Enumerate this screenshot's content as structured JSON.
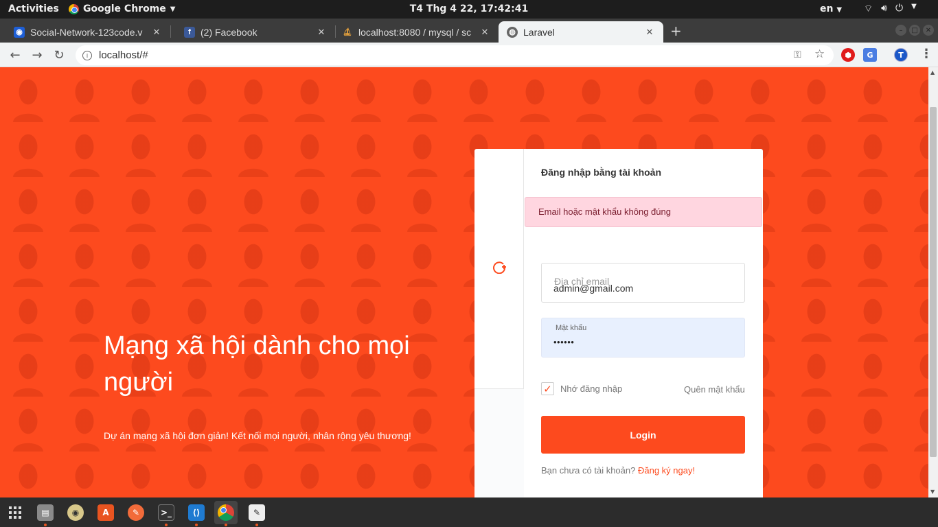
{
  "system_bar": {
    "activities": "Activities",
    "app_name": "Google Chrome",
    "clock": "T4 Thg 4 22, 17:42:41",
    "language": "en"
  },
  "tabs": [
    {
      "title": "Social-Network-123code.v",
      "favicon": "vscode-live-icon",
      "active": false
    },
    {
      "title": "(2) Facebook",
      "favicon": "facebook-icon",
      "active": false
    },
    {
      "title": "localhost:8080 / mysql / sc",
      "favicon": "phpmyadmin-icon",
      "active": false
    },
    {
      "title": "Laravel",
      "favicon": "globe-icon",
      "active": true
    }
  ],
  "address_bar": {
    "url": "localhost/#",
    "profile_initial": "T"
  },
  "hero": {
    "title": "Mạng xã hội dành cho mọi người",
    "subtitle": "Dự án mạng xã hội đơn giản! Kết nối mọi người, nhân rộng yêu thương!"
  },
  "login_card": {
    "heading": "Đăng nhập bằng tài khoản",
    "error_message": "Email hoặc mật khẩu không đúng",
    "email_placeholder": "Địa chỉ email",
    "email_value": "admin@gmail.com",
    "password_label": "Mật khẩu",
    "password_value": "••••••",
    "remember_label": "Nhớ đăng nhập",
    "remember_checked": true,
    "forgot_label": "Quên mật khẩu",
    "login_label": "Login",
    "signup_prompt": "Bạn chưa có tài khoản?",
    "signup_link": "Đăng ký ngay!"
  },
  "colors": {
    "brand": "#fd4a1e",
    "alert_bg": "#ffd6e0",
    "autofill_bg": "#e8f0fe"
  },
  "dock": [
    "app-grid-icon",
    "file-manager-icon",
    "camera-icon",
    "software-center-icon",
    "postman-icon",
    "terminal-icon",
    "vscode-icon",
    "chrome-icon",
    "text-editor-icon"
  ]
}
